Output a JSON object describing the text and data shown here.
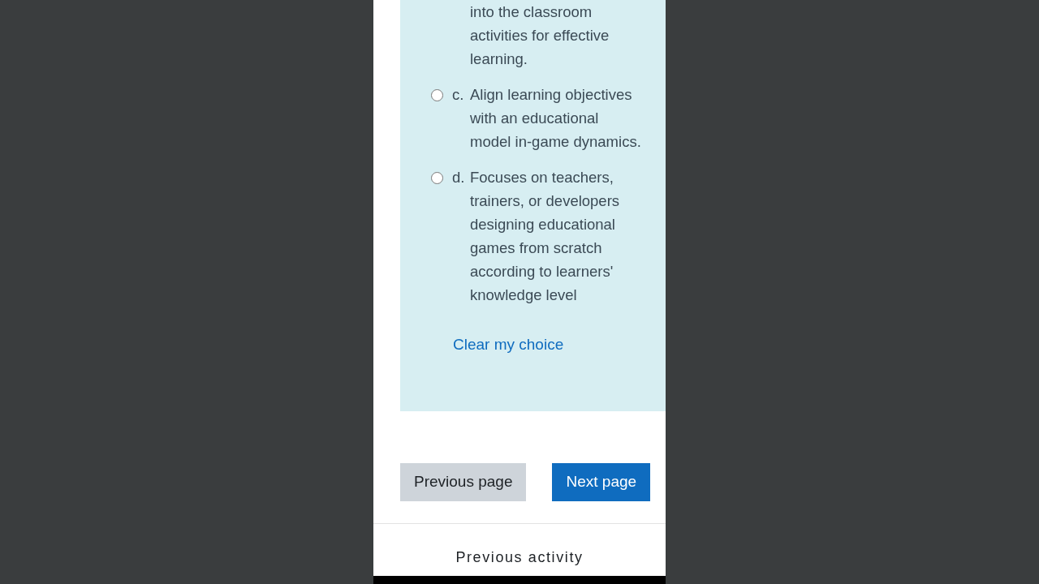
{
  "question": {
    "options": [
      {
        "kind": "partial",
        "text": "into the classroom activities for effective learning."
      },
      {
        "kind": "option",
        "letter": "c.",
        "text": "Align learning objectives with an educational model in-game dynamics.",
        "selected": false
      },
      {
        "kind": "option",
        "letter": "d.",
        "text": "Focuses on teachers, trainers, or developers designing educational games from scratch according to learners' knowledge level",
        "selected": false
      }
    ],
    "clear_link": "Clear my choice"
  },
  "navigation": {
    "previous": "Previous page",
    "next": "Next page"
  },
  "footer": {
    "previous_activity": "Previous activity"
  }
}
